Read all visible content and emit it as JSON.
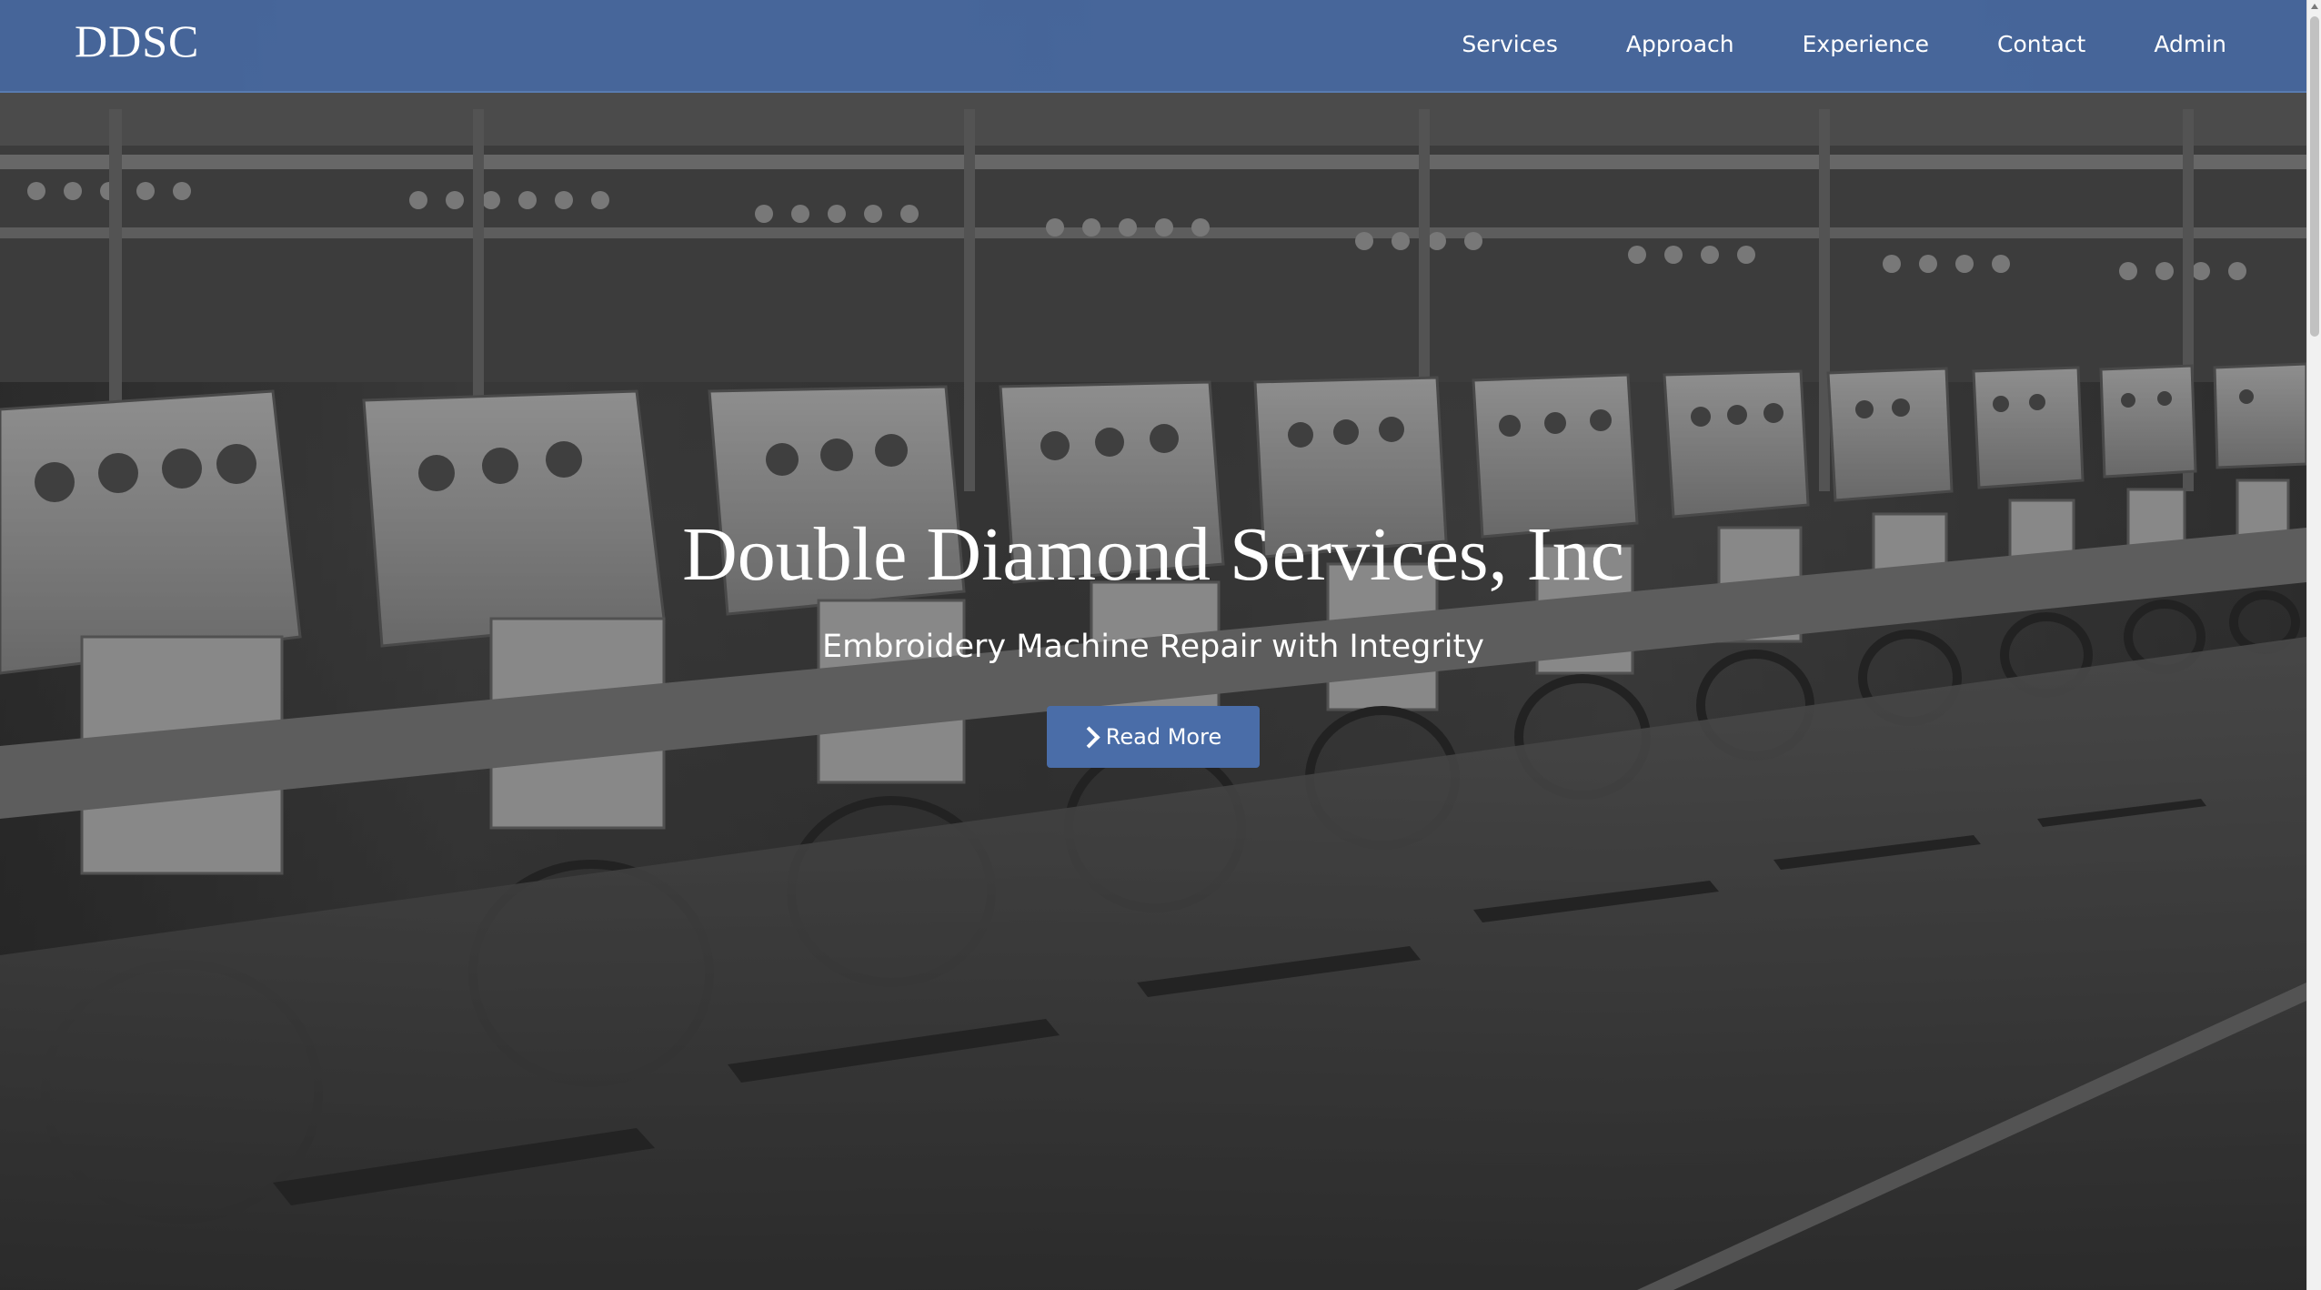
{
  "navbar": {
    "brand": "DDSC",
    "links": [
      "Services",
      "Approach",
      "Experience",
      "Contact",
      "Admin"
    ],
    "background_color": "#4a6da8"
  },
  "hero": {
    "title": "Double Diamond Services, Inc",
    "subtitle": "Embroidery Machine Repair with Integrity",
    "button_label": "Read More",
    "button_icon": "chevron-right-icon",
    "button_color": "#4a6da8",
    "background_description_icon": "embroidery-machines-photo"
  }
}
